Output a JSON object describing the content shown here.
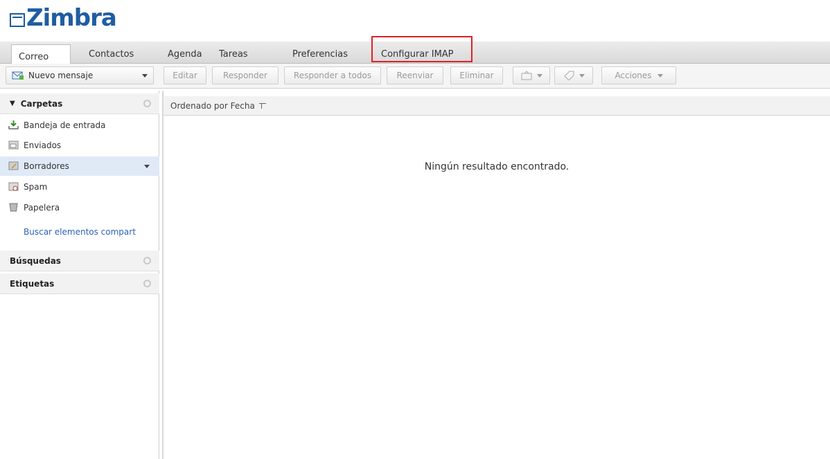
{
  "app": {
    "logo_text": "Zimbra"
  },
  "tabs": [
    {
      "label": "Correo",
      "active": true
    },
    {
      "label": "Contactos"
    },
    {
      "label": "Agenda"
    },
    {
      "label": "Tareas"
    },
    {
      "label": "Preferencias"
    },
    {
      "label": "Configurar IMAP",
      "highlighted": true
    }
  ],
  "toolbar": {
    "new_message": "Nuevo mensaje",
    "edit": "Editar",
    "reply": "Responder",
    "reply_all": "Responder a todos",
    "forward": "Reenviar",
    "delete": "Eliminar",
    "actions": "Acciones"
  },
  "sidebar": {
    "folders_header": "Carpetas",
    "folders": [
      {
        "label": "Bandeja de entrada",
        "icon": "inbox-icon"
      },
      {
        "label": "Enviados",
        "icon": "sent-icon"
      },
      {
        "label": "Borradores",
        "icon": "drafts-icon",
        "selected": true
      },
      {
        "label": "Spam",
        "icon": "spam-icon"
      },
      {
        "label": "Papelera",
        "icon": "trash-icon"
      }
    ],
    "shared_link": "Buscar elementos compart",
    "searches_header": "Búsquedas",
    "tags_header": "Etiquetas"
  },
  "list": {
    "sort_label": "Ordenado por Fecha",
    "empty_message": "Ningún resultado encontrado."
  },
  "colors": {
    "brand": "#1f5da2",
    "highlight": "#e21f26",
    "selected": "#dfeaf6"
  }
}
